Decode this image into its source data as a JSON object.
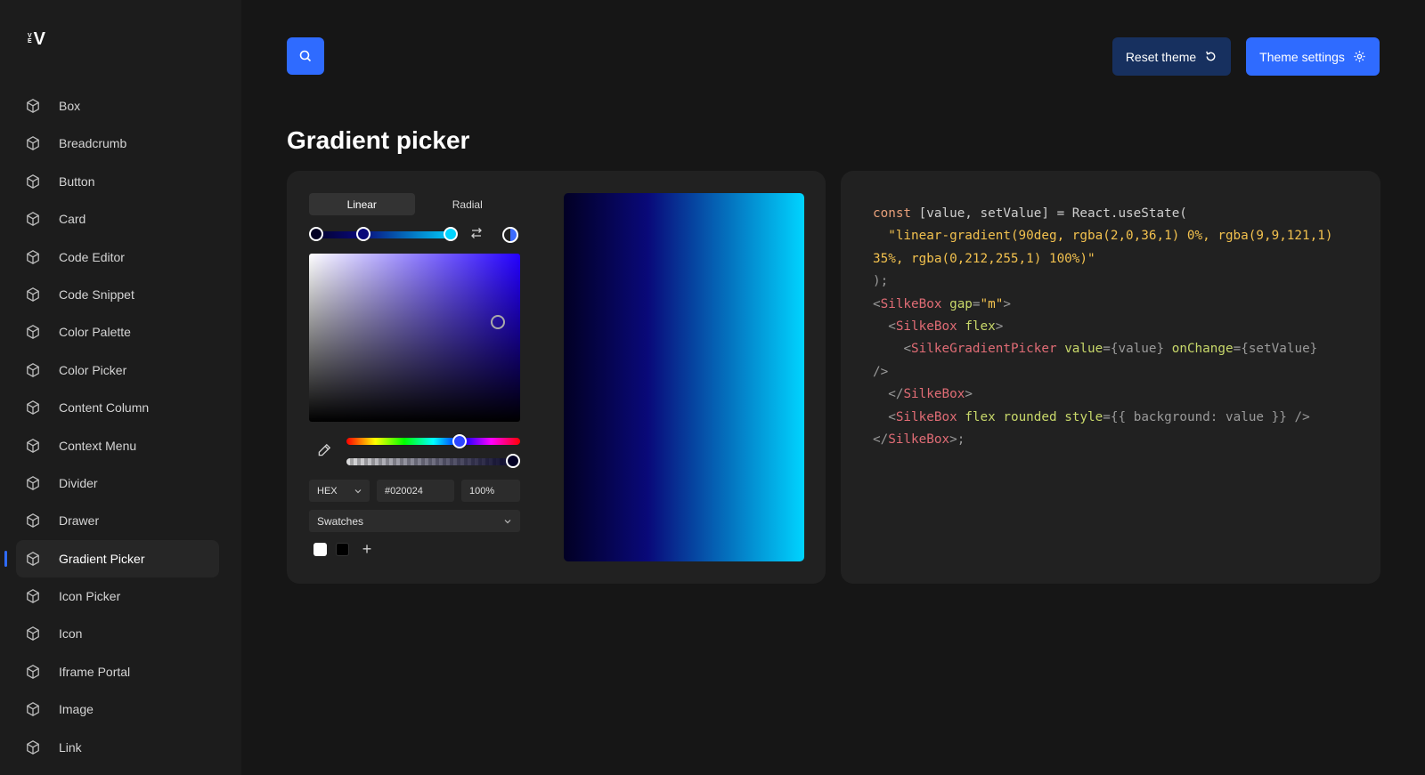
{
  "logo": {
    "small_top": "V",
    "small_bottom": "E",
    "big": "V"
  },
  "sidebar": {
    "items": [
      {
        "label": "Box"
      },
      {
        "label": "Breadcrumb"
      },
      {
        "label": "Button"
      },
      {
        "label": "Card"
      },
      {
        "label": "Code Editor"
      },
      {
        "label": "Code Snippet"
      },
      {
        "label": "Color Palette"
      },
      {
        "label": "Color Picker"
      },
      {
        "label": "Content Column"
      },
      {
        "label": "Context Menu"
      },
      {
        "label": "Divider"
      },
      {
        "label": "Drawer"
      },
      {
        "label": "Gradient Picker",
        "active": true
      },
      {
        "label": "Icon Picker"
      },
      {
        "label": "Icon"
      },
      {
        "label": "Iframe Portal"
      },
      {
        "label": "Image"
      },
      {
        "label": "Link"
      }
    ]
  },
  "header": {
    "search_icon": "search-icon",
    "reset_label": "Reset theme",
    "settings_label": "Theme settings"
  },
  "page": {
    "title": "Gradient picker"
  },
  "picker": {
    "tabs": [
      "Linear",
      "Radial"
    ],
    "active_tab": "Linear",
    "format": "HEX",
    "hex_value": "#020024",
    "alpha_value": "100%",
    "swatches_label": "Swatches",
    "stops": [
      "rgb(2,0,36)",
      "rgb(9,9,121)",
      "rgb(0,212,255)"
    ],
    "swatch_colors": [
      "#ffffff",
      "#000000"
    ],
    "add_swatch": "+"
  },
  "code": {
    "l1a": "const",
    "l1b": " [value, setValue] = React.useState(",
    "l2": "\"linear-gradient(90deg, rgba(2,0,36,1) 0%, rgba(9,9,121,1) 35%, rgba(0,212,255,1) 100%)\"",
    "l3": ");",
    "t_box": "SilkeBox",
    "a_gap": "gap",
    "v_gap": "\"m\"",
    "a_flex": "flex",
    "t_gp": "SilkeGradientPicker",
    "a_value": "value",
    "v_value": "{value}",
    "a_onchange": "onChange",
    "v_onchange": "{setValue}",
    "a_rounded": "rounded",
    "a_style": "style",
    "v_style": "{{ background: value }}"
  },
  "colors": {
    "accent": "#2f6bff",
    "reset_bg": "#17305f",
    "background": "#161616",
    "sidebar": "#1c1c1c",
    "panel": "#212121"
  }
}
